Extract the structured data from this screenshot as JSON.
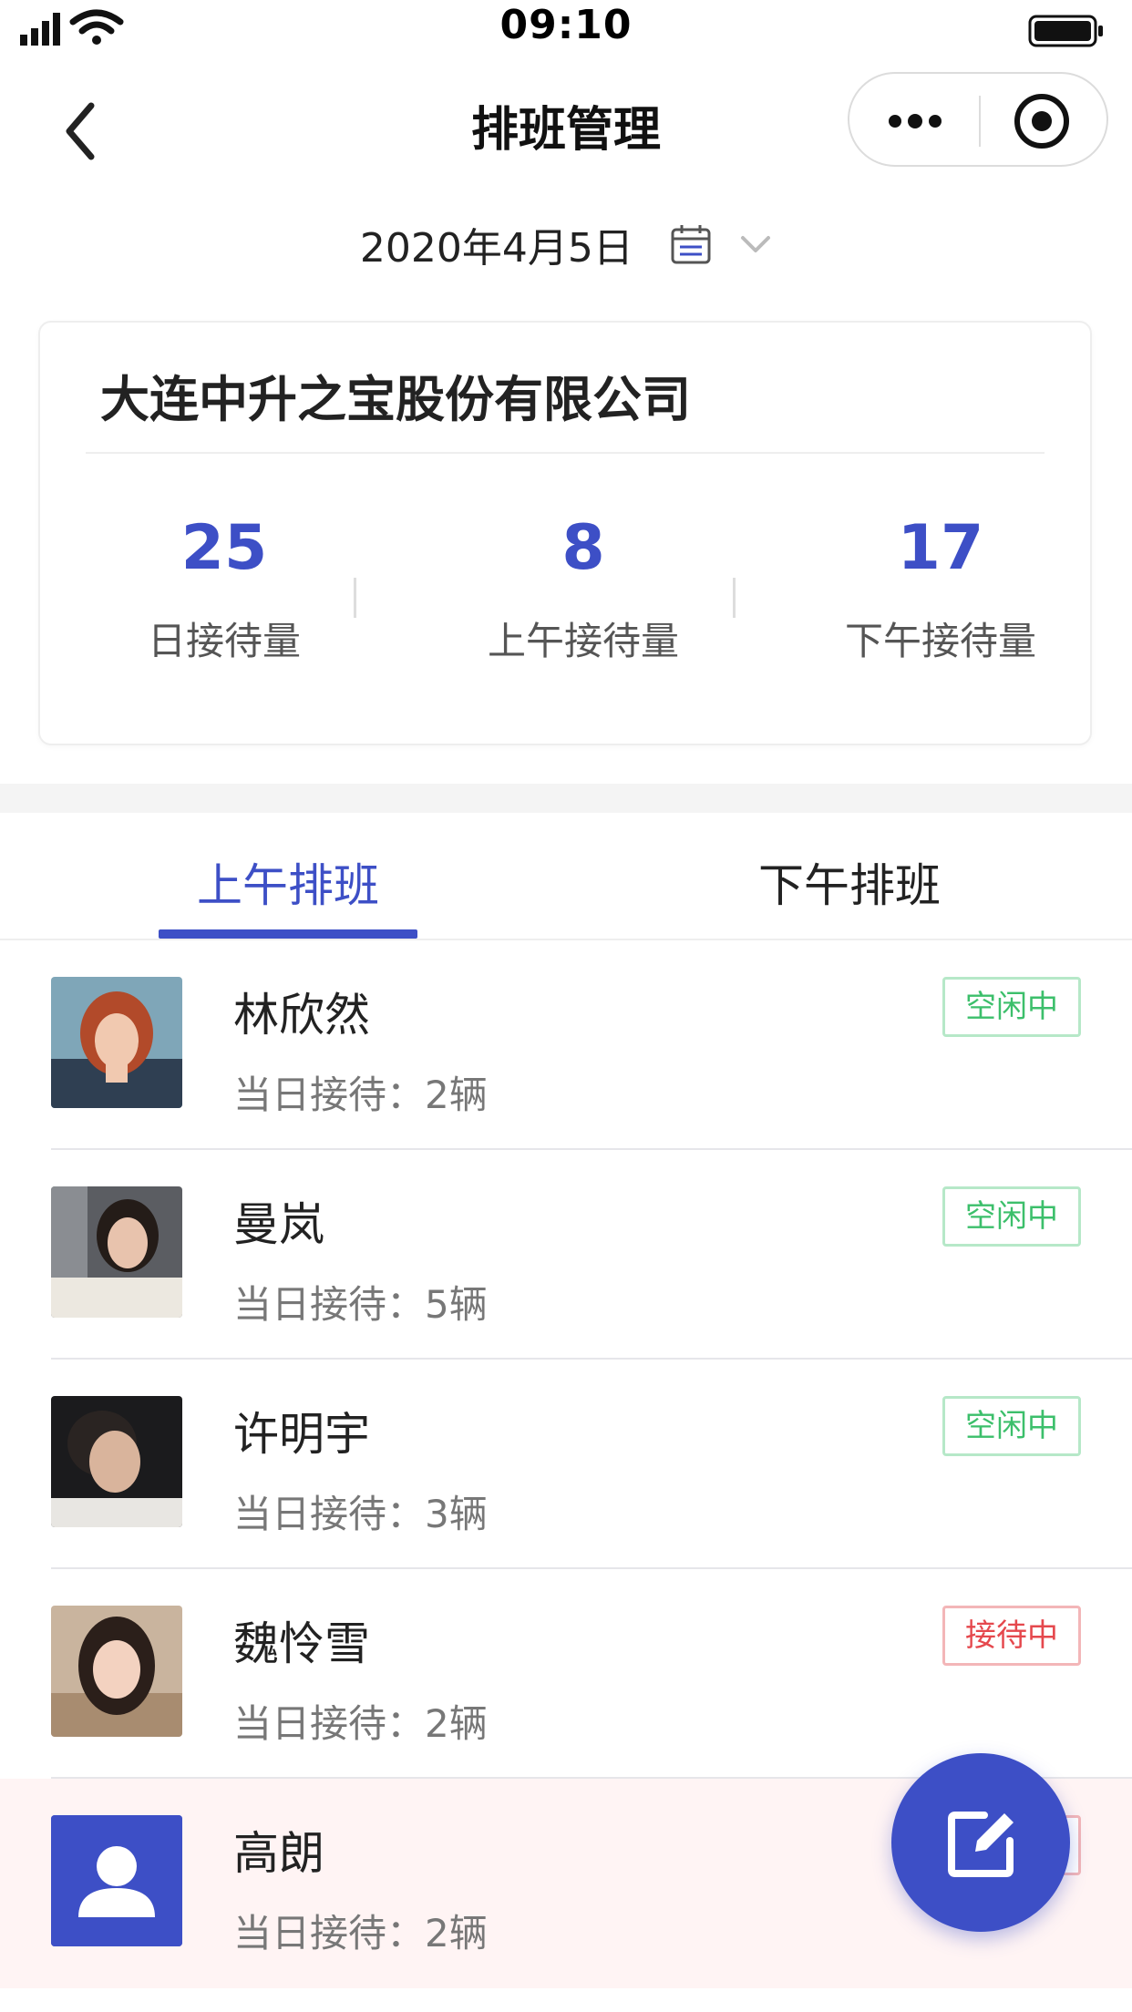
{
  "status_bar": {
    "time": "09:10"
  },
  "nav": {
    "title": "排班管理"
  },
  "date": {
    "text": "2020年4月5日"
  },
  "company": {
    "name": "大连中升之宝股份有限公司",
    "stats": [
      {
        "value": "25",
        "label": "日接待量"
      },
      {
        "value": "8",
        "label": "上午接待量"
      },
      {
        "value": "17",
        "label": "下午接待量"
      }
    ]
  },
  "tabs": [
    {
      "label": "上午排班",
      "active": true
    },
    {
      "label": "下午排班",
      "active": false
    }
  ],
  "colors": {
    "accent": "#3d4fc6",
    "idle": "#3cbf6b",
    "busy": "#e5484d"
  },
  "staff": [
    {
      "name": "林欣然",
      "count_prefix": "当日接待：",
      "count": "2辆",
      "status": "空闲中",
      "status_type": "idle",
      "avatar": "photo-woman-red-hair"
    },
    {
      "name": "曼岚",
      "count_prefix": "当日接待：",
      "count": "5辆",
      "status": "空闲中",
      "status_type": "idle",
      "avatar": "photo-woman-dark-hair"
    },
    {
      "name": "许明宇",
      "count_prefix": "当日接待：",
      "count": "3辆",
      "status": "空闲中",
      "status_type": "idle",
      "avatar": "photo-man-profile"
    },
    {
      "name": "魏怜雪",
      "count_prefix": "当日接待：",
      "count": "2辆",
      "status": "接待中",
      "status_type": "busy",
      "avatar": "photo-woman-long-hair"
    },
    {
      "name": "高朗",
      "count_prefix": "当日接待：",
      "count": "2辆",
      "status": "",
      "status_type": "busy",
      "avatar": "default-user-icon"
    }
  ]
}
